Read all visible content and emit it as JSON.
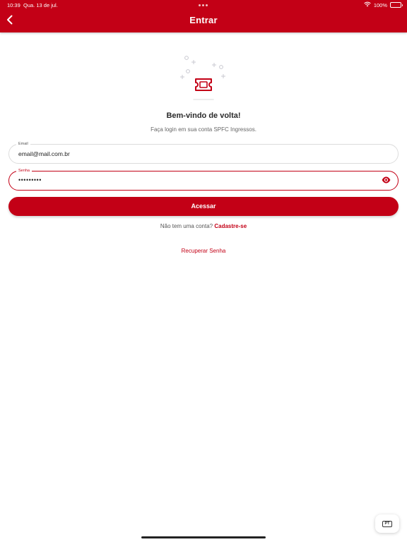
{
  "status_bar": {
    "time": "10:39",
    "date": "Qua. 13 de jul.",
    "battery": "100%"
  },
  "header": {
    "title": "Entrar",
    "background_color": "#c30016"
  },
  "icons": {
    "back": "chevron-left-icon",
    "illustration": "ticket-icon",
    "password_visibility": "eye-icon",
    "wifi": "wifi-icon",
    "battery": "battery-icon"
  },
  "welcome": {
    "title": "Bem-vindo de volta!",
    "subtitle": "Faça login em sua conta SPFC Ingressos."
  },
  "form": {
    "email": {
      "label": "Email",
      "value": "email@mail.com.br"
    },
    "password": {
      "label": "Senha",
      "value": "•••••••••"
    },
    "submit_label": "Acessar"
  },
  "signup": {
    "prompt": "Não tem uma conta?",
    "link": "Cadastre-se"
  },
  "recover_password": "Recuperar Senha",
  "language": {
    "code": "PT"
  },
  "accent_color": "#c30016"
}
